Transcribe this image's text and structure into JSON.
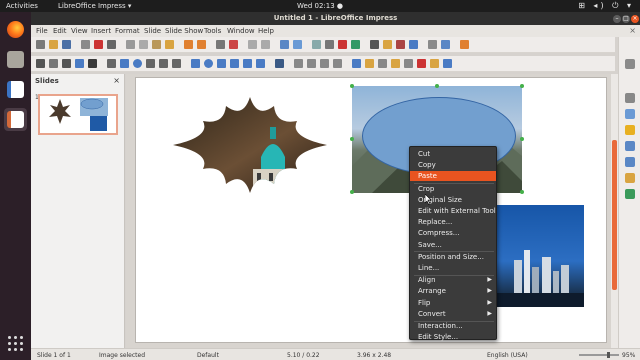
{
  "topbar": {
    "activities": "Activities",
    "app_menu": "LibreOffice Impress ▾",
    "clock": "Wed 02:13 ●",
    "tray": "⊞ ◂) ⏻ ▾"
  },
  "dock": {
    "items": [
      {
        "name": "firefox-icon",
        "color": "#e66000"
      },
      {
        "name": "files-icon",
        "color": "#b4b0a8"
      },
      {
        "name": "writer-icon",
        "color": "#3b74c4"
      },
      {
        "name": "impress-icon",
        "color": "#d3693a"
      }
    ]
  },
  "window": {
    "title": "Untitled 1 - LibreOffice Impress",
    "close_glyph": "×",
    "minimize_glyph": "–",
    "maximize_glyph": "□"
  },
  "menubar": {
    "items": [
      "File",
      "Edit",
      "View",
      "Insert",
      "Format",
      "Slide",
      "Slide Show",
      "Tools",
      "Window",
      "Help"
    ],
    "close_glyph": "×"
  },
  "slides_pane": {
    "title": "Slides",
    "close_glyph": "×",
    "slide_number": "1"
  },
  "context_menu": {
    "items": [
      {
        "label": "Cut",
        "highlight": false,
        "submenu": false
      },
      {
        "label": "Copy",
        "highlight": false,
        "submenu": false
      },
      {
        "label": "Paste",
        "highlight": true,
        "submenu": false
      },
      {
        "label": "Crop",
        "highlight": false,
        "submenu": false
      },
      {
        "label": "Original Size",
        "highlight": false,
        "submenu": false
      },
      {
        "label": "Edit with External Tool",
        "highlight": false,
        "submenu": false
      },
      {
        "label": "Replace...",
        "highlight": false,
        "submenu": false
      },
      {
        "label": "Compress...",
        "highlight": false,
        "submenu": false
      },
      {
        "label": "Save...",
        "highlight": false,
        "submenu": false
      },
      {
        "label": "Position and Size...",
        "highlight": false,
        "submenu": false
      },
      {
        "label": "Line...",
        "highlight": false,
        "submenu": false
      },
      {
        "label": "Align",
        "highlight": false,
        "submenu": true
      },
      {
        "label": "Arrange",
        "highlight": false,
        "submenu": true
      },
      {
        "label": "Flip",
        "highlight": false,
        "submenu": true
      },
      {
        "label": "Convert",
        "highlight": false,
        "submenu": true
      },
      {
        "label": "Interaction...",
        "highlight": false,
        "submenu": false
      },
      {
        "label": "Edit Style...",
        "highlight": false,
        "submenu": false
      }
    ],
    "submenu_glyph": "▶"
  },
  "statusbar": {
    "slide": "Slide 1 of 1",
    "selection": "Image selected",
    "layout": "Default",
    "position": "5.10 / 0.22",
    "size": "3.96 x 2.48",
    "language": "English (USA)",
    "zoom": "95%"
  },
  "colors": {
    "accent": "#e95420",
    "ellipse_fill": "#729fcf",
    "handle": "#44b04a"
  }
}
